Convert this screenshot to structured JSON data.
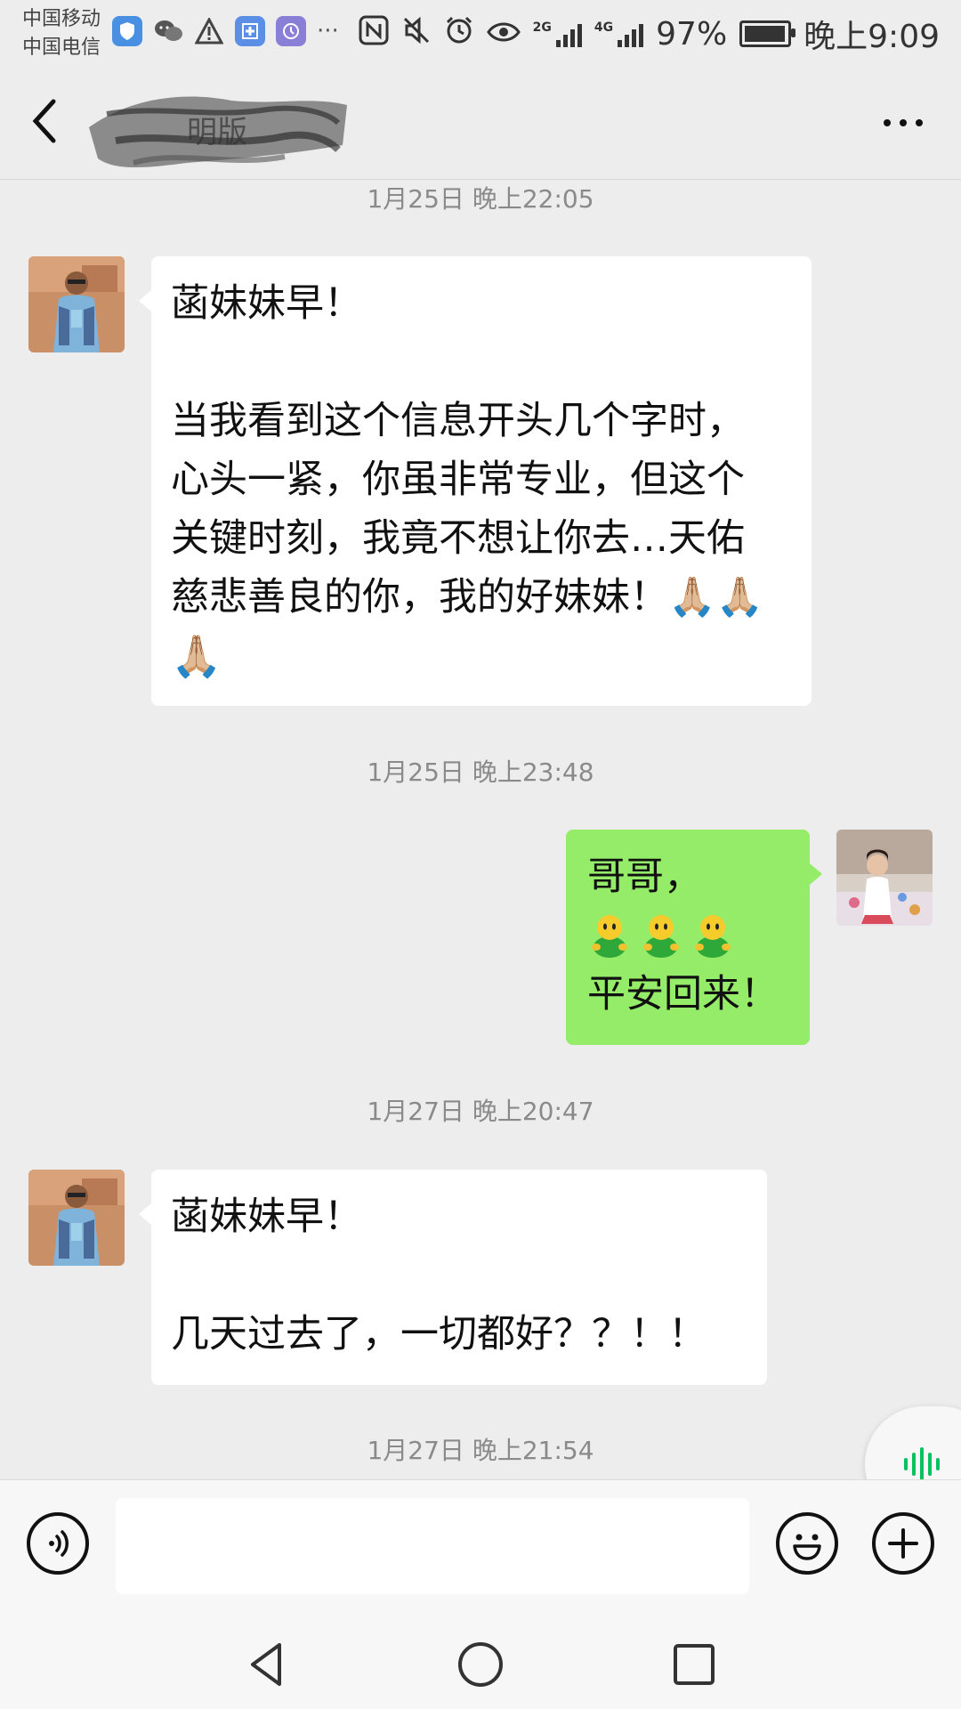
{
  "status_bar": {
    "carrier_1": "中国移动",
    "carrier_2": "中国电信",
    "left_icons": [
      "shield-icon",
      "wechat-icon",
      "warning-icon",
      "hospital-app-icon",
      "clock-app-icon",
      "more-notifications-icon"
    ],
    "more_notifications": "···",
    "network_1": "2G",
    "network_2": "4G",
    "battery_percent": "97%",
    "battery_level": 0.97,
    "time": "晚上9:09"
  },
  "header": {
    "back_icon": "chevron-left-icon",
    "title_visible_fragment": "明版",
    "more_icon": "more-dots-icon"
  },
  "messages": [
    {
      "type": "timestamp",
      "text": "1月25日 晚上22:05"
    },
    {
      "type": "incoming",
      "lines": [
        "菡妹妹早！",
        "",
        "当我看到这个信息开头几个字时，",
        "心头一紧，你虽非常专业，但这个",
        "关键时刻，我竟不想让你去…天佑",
        "慈悲善良的你，我的好妹妹！🙏🏼🙏🏼",
        "🙏🏼"
      ]
    },
    {
      "type": "timestamp",
      "text": "1月25日 晚上23:48"
    },
    {
      "type": "outgoing",
      "line_1": "哥哥，",
      "smiley_count": 3,
      "line_3": "平安回来！"
    },
    {
      "type": "timestamp",
      "text": "1月27日 晚上20:47"
    },
    {
      "type": "incoming",
      "lines": [
        "菡妹妹早！",
        "",
        "几天过去了，一切都好？？！！"
      ]
    },
    {
      "type": "timestamp",
      "text": "1月27日 晚上21:54"
    }
  ],
  "input_bar": {
    "voice_icon": "voice-mode-icon",
    "input_value": "",
    "emoji_icon": "emoji-icon",
    "plus_icon": "plus-icon",
    "floating_icon": "voice-wave-icon"
  },
  "nav_bar": {
    "icons": [
      "back-triangle-icon",
      "home-circle-icon",
      "recents-square-icon"
    ]
  },
  "colors": {
    "background": "#ededed",
    "outgoing_bubble": "#95ec69",
    "incoming_bubble": "#ffffff",
    "timestamp_text": "#8a8a8a",
    "accent_green": "#07c160"
  }
}
